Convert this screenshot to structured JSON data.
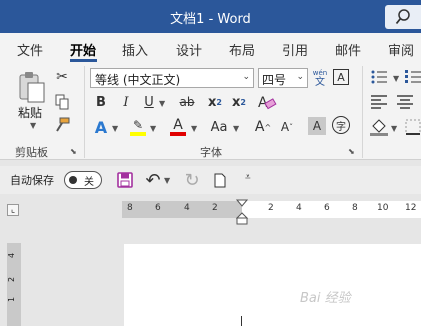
{
  "title": "文档1  -  Word",
  "tabs": [
    "文件",
    "开始",
    "插入",
    "设计",
    "布局",
    "引用",
    "邮件",
    "审阅"
  ],
  "clipboard": {
    "paste_label": "粘贴",
    "group_label": "剪贴板"
  },
  "font": {
    "name": "等线 (中文正文)",
    "size": "四号",
    "wen": "wén",
    "wen_char": "文",
    "bold": "B",
    "italic": "I",
    "underline": "U",
    "strike": "ab",
    "sub": "x",
    "sub_small": "2",
    "sup": "x",
    "sup_small": "2",
    "effects": "A",
    "highlight": "ab",
    "color": "A",
    "case": "Aa",
    "grow": "A",
    "shrink": "A",
    "shade": "A",
    "enclose": "字",
    "border_char": "A",
    "group_label": "字体"
  },
  "qat": {
    "autosave": "自动保存",
    "toggle": "关"
  },
  "ruler": {
    "left_ticks": [
      "8",
      "6",
      "4",
      "2"
    ],
    "right_ticks": [
      "2",
      "4",
      "6",
      "8",
      "10",
      "12"
    ],
    "vertical_ticks": [
      "4",
      "2",
      "1"
    ]
  },
  "watermark": "Bai  经验",
  "colors": {
    "accent": "#2b579a",
    "highlight_yellow": "#ffff00",
    "font_red": "#e00000",
    "save_purple": "#a3319f"
  }
}
